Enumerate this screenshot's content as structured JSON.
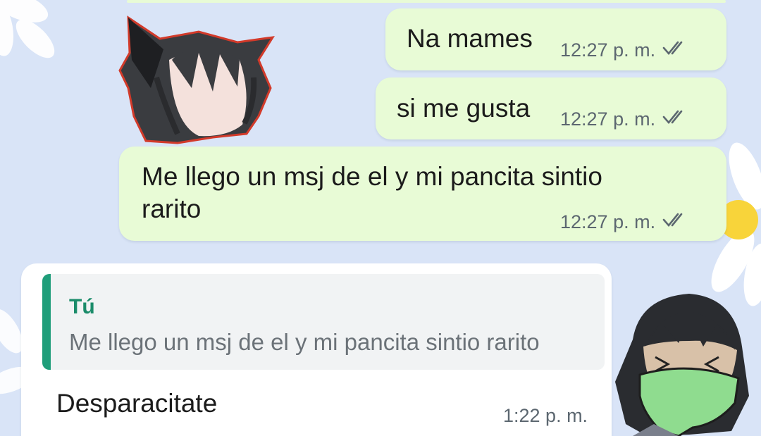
{
  "messages": [
    {
      "text": "Na mames",
      "time": "12:27 p. m.",
      "status": "read-double-check-icon"
    },
    {
      "text": "si me gusta",
      "time": "12:27 p. m.",
      "status": "read-double-check-icon"
    },
    {
      "text": "Me llego un msj de el y mi pancita sintio\nrarito",
      "time": "12:27 p. m.",
      "status": "read-double-check-icon"
    }
  ],
  "reply": {
    "quoted_author": "Tú",
    "quoted_text": "Me llego un msj de el y mi pancita sintio rarito",
    "text": "Desparacitate",
    "time": "1:22 p. m."
  },
  "colors": {
    "wallpaper": "#d9e4f7",
    "outgoing_bubble": "#e8fbd6",
    "incoming_bubble": "#ffffff",
    "quote_accent": "#1f9e7a",
    "read_ticks": "#5c6770"
  }
}
